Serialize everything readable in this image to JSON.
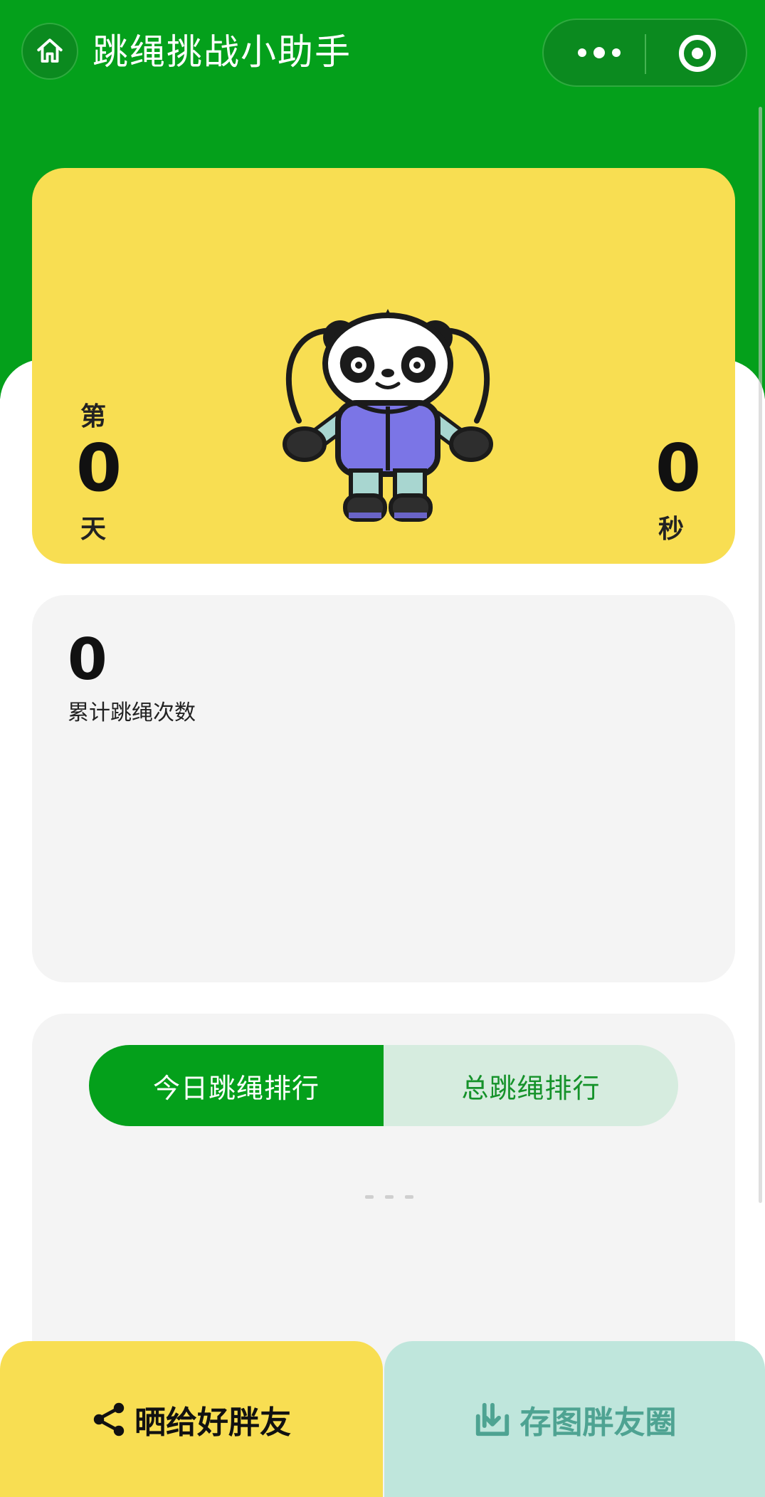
{
  "nav": {
    "title": "跳绳挑战小助手"
  },
  "hero": {
    "day_prefix": "第",
    "day_value": "0",
    "day_unit": "天",
    "seconds_value": "0",
    "seconds_unit": "秒"
  },
  "stats": {
    "total_count": "0",
    "total_label": "累计跳绳次数"
  },
  "ranking": {
    "tabs": [
      {
        "label": "今日跳绳排行",
        "active": true
      },
      {
        "label": "总跳绳排行",
        "active": false
      }
    ]
  },
  "actions": {
    "share_label": "晒给好胖友",
    "save_label": "存图胖友圈"
  },
  "colors": {
    "brand_green": "#04a01b",
    "card_yellow": "#f8de52",
    "card_gray": "#f4f4f4",
    "save_teal": "#bfe6dc"
  },
  "icons": {
    "home": "home-icon",
    "more": "more-dots-icon",
    "close": "target-close-icon",
    "share": "share-icon",
    "save": "download-icon"
  }
}
